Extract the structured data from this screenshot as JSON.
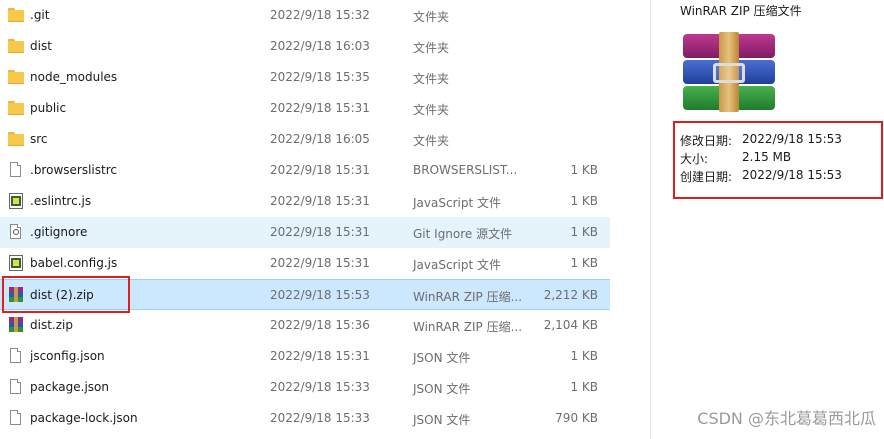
{
  "files": [
    {
      "icon": "folder-icon",
      "name": ".git",
      "date": "2022/9/18 15:32",
      "type": "文件夹",
      "size": ""
    },
    {
      "icon": "folder-icon",
      "name": "dist",
      "date": "2022/9/18 16:03",
      "type": "文件夹",
      "size": ""
    },
    {
      "icon": "folder-icon",
      "name": "node_modules",
      "date": "2022/9/18 15:35",
      "type": "文件夹",
      "size": ""
    },
    {
      "icon": "folder-icon",
      "name": "public",
      "date": "2022/9/18 15:31",
      "type": "文件夹",
      "size": ""
    },
    {
      "icon": "folder-icon",
      "name": "src",
      "date": "2022/9/18 16:05",
      "type": "文件夹",
      "size": ""
    },
    {
      "icon": "document-icon",
      "name": ".browserslistrc",
      "date": "2022/9/18 15:31",
      "type": "BROWSERSLIST...",
      "size": "1 KB"
    },
    {
      "icon": "javascript-file-icon",
      "name": ".eslintrc.js",
      "date": "2022/9/18 15:31",
      "type": "JavaScript 文件",
      "size": "1 KB"
    },
    {
      "icon": "gitignore-file-icon",
      "name": ".gitignore",
      "date": "2022/9/18 15:31",
      "type": "Git Ignore 源文件",
      "size": "1 KB"
    },
    {
      "icon": "javascript-file-icon",
      "name": "babel.config.js",
      "date": "2022/9/18 15:31",
      "type": "JavaScript 文件",
      "size": "1 KB"
    },
    {
      "icon": "winrar-archive-icon",
      "name": "dist (2).zip",
      "date": "2022/9/18 15:53",
      "type": "WinRAR ZIP 压缩...",
      "size": "2,212 KB"
    },
    {
      "icon": "winrar-archive-icon",
      "name": "dist.zip",
      "date": "2022/9/18 15:36",
      "type": "WinRAR ZIP 压缩...",
      "size": "2,104 KB"
    },
    {
      "icon": "document-icon",
      "name": "jsconfig.json",
      "date": "2022/9/18 15:31",
      "type": "JSON 文件",
      "size": "1 KB"
    },
    {
      "icon": "document-icon",
      "name": "package.json",
      "date": "2022/9/18 15:33",
      "type": "JSON 文件",
      "size": "1 KB"
    },
    {
      "icon": "document-icon",
      "name": "package-lock.json",
      "date": "2022/9/18 15:33",
      "type": "JSON 文件",
      "size": "790 KB"
    }
  ],
  "preview": {
    "title": "WinRAR ZIP 压缩文件",
    "icon": "winrar-archive-icon",
    "properties": [
      {
        "label": "修改日期:",
        "value": "2022/9/18 15:53"
      },
      {
        "label": "大小:",
        "value": "2.15 MB"
      },
      {
        "label": "创建日期:",
        "value": "2022/9/18 15:53"
      }
    ]
  },
  "watermark": "CSDN @东北葛葛西北瓜",
  "colors": {
    "selection": "#cce8ff",
    "hover": "#e5f3fb",
    "annotation": "#e02020"
  }
}
